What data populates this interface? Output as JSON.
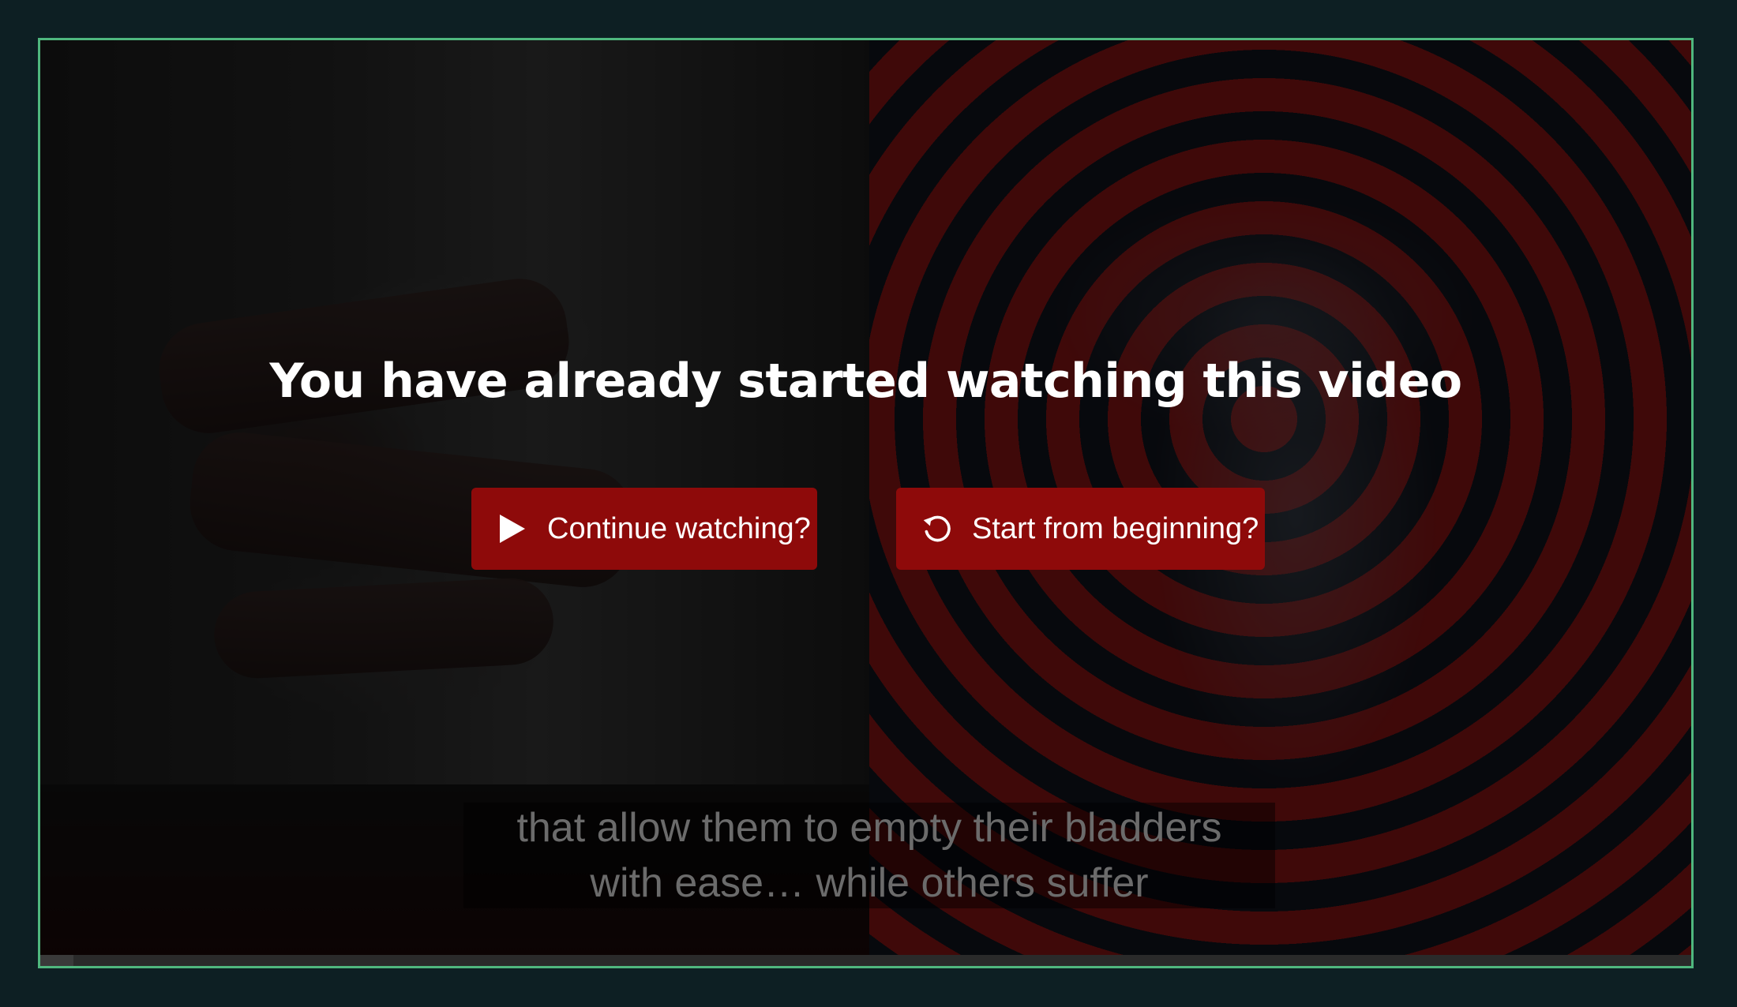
{
  "overlay": {
    "title": "You have already started watching this video",
    "continue_button": {
      "label": "Continue watching?",
      "icon": "play-icon"
    },
    "restart_button": {
      "label": "Start from beginning?",
      "icon": "restart-icon"
    }
  },
  "caption": {
    "line1": "that allow them to empty their bladders",
    "line2": "with ease… while others suffer"
  },
  "colors": {
    "page_background": "#0d1f23",
    "player_border": "#4fb77e",
    "button_background": "#8e0a0a",
    "title_text": "#ffffff"
  },
  "playback": {
    "progress_fraction": 0.02
  }
}
